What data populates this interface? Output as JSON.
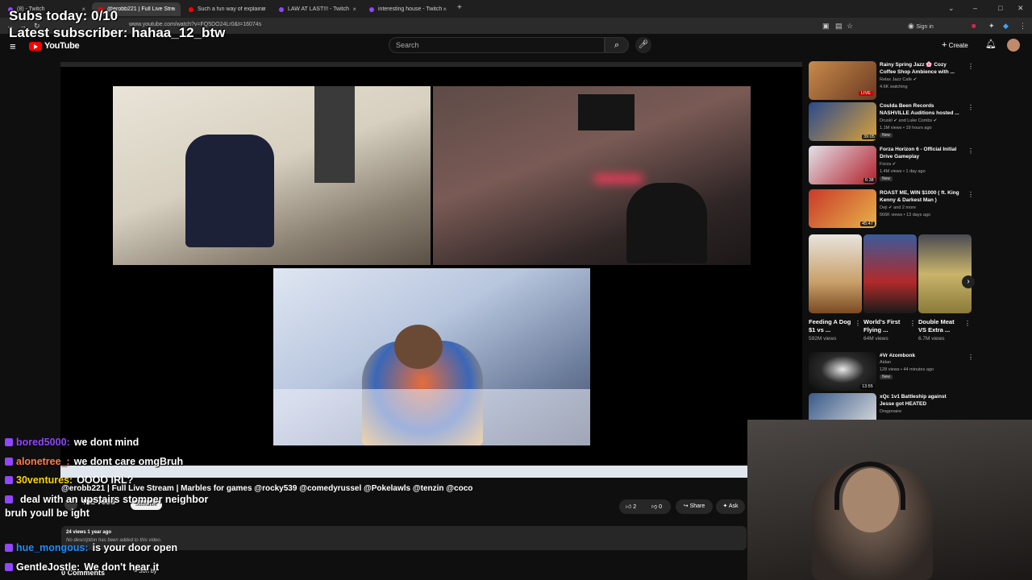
{
  "browser": {
    "tabs": [
      {
        "label": "(8) - Twitch",
        "active": false,
        "icon_color": "#9146ff"
      },
      {
        "label": "@erobb221 | Full Live Stream |",
        "active": true,
        "icon_color": "#ff0000"
      },
      {
        "label": "Such a fun way of explaining co",
        "active": false,
        "icon_color": "#ff0000"
      },
      {
        "label": "LAW AT LAST!!! - Twitch",
        "active": false,
        "icon_color": "#9146ff"
      },
      {
        "label": "interesting house - Twitch",
        "active": false,
        "icon_color": "#9146ff"
      }
    ],
    "url": "www.youtube.com/watch?v=FQ5DO24Lr0&t=16074s",
    "sign_in": "Sign in"
  },
  "youtube": {
    "logo_text": "YouTube",
    "search_placeholder": "Search",
    "create_label": "Create",
    "video": {
      "title": "@erobb221 | Full Live Stream | Marbles for games @rocky539 @comedyrussel @Pokelawls @tenzin @coco",
      "channel": "THE VODS",
      "subscribe_label": "Subscribe",
      "likes": "2",
      "dislikes": "0",
      "share_label": "Share",
      "ask_label": "Ask",
      "stats": "24 views  1 year ago",
      "description": "No description has been added to this video.",
      "comments": "0 Comments",
      "sort_label": "Sort by"
    },
    "recommendations": [
      {
        "title": "Rainy Spring Jazz 🌸 Cozy Coffee Shop Ambience with ...",
        "channel": "Relax Jazz Cafe ✔",
        "meta": "4.6K watching",
        "badge": "",
        "duration": "",
        "live": "LIVE",
        "thumb": "#a0623a"
      },
      {
        "title": "Coulda Been Records NASHVILLE Auditions hosted ...",
        "channel": "DruskI ✔ and Luke Combs ✔",
        "meta": "1.1M views • 19 hours ago",
        "badge": "New",
        "duration": "39:05",
        "live": "",
        "thumb": "#2a4a8c"
      },
      {
        "title": "Forza Horizon 6 - Official Initial Drive Gameplay",
        "channel": "Forza ✔",
        "meta": "1.4M views • 1 day ago",
        "badge": "New",
        "duration": "6:38",
        "live": "",
        "thumb": "#c8c8d0"
      },
      {
        "title": "ROAST ME, WIN $1000 ( ft. King Kenny & Darkest Man )",
        "channel": "Deji ✔ and 2 more",
        "meta": "566K views • 13 days ago",
        "badge": "",
        "duration": "45:47",
        "live": "",
        "thumb": "#b53a2a"
      },
      {
        "title": "#Vr #zombonk",
        "channel": "Aidan",
        "meta": "128 views • 44 minutes ago",
        "badge": "New",
        "duration": "13:55",
        "live": "",
        "thumb": "#111111"
      },
      {
        "title": "xQc 1v1 Battleship against Jesse got HEATED",
        "channel": "Dragonaire",
        "meta": "",
        "badge": "",
        "duration": "",
        "live": "",
        "thumb": "#3a5a8a"
      }
    ],
    "shorts": [
      {
        "title": "Feeding A Dog $1 vs ...",
        "views": "592M views",
        "thumb": "#c9a06a"
      },
      {
        "title": "World's First Flying ...",
        "views": "64M views",
        "thumb": "#b22a2a"
      },
      {
        "title": "Double Meat VS Extra ...",
        "views": "6.7M views",
        "thumb": "#c9b46a"
      }
    ]
  },
  "overlay": {
    "subs_today": "Subs today: 0/10",
    "latest_subscriber": "Latest subscriber: hahaa_12_btw",
    "chat": [
      {
        "user": "bored5000:",
        "msg": "we dont mind",
        "color": "#9146ff"
      },
      {
        "user": "alonetree_:",
        "msg": "we dont care omgBruh",
        "color": "#ff7f50"
      },
      {
        "user": "30ventures:",
        "msg": "OOOO IRL?",
        "color": "#ffd700"
      },
      {
        "user": "",
        "msg": "deal with an upstairs stomper neighbor bruh youll be ight",
        "color": "#9146ff"
      },
      {
        "user": "hue_mongous:",
        "msg": "is your door open",
        "color": "#1e90ff"
      },
      {
        "user": "GentleJostle:",
        "msg": "We don't hear it",
        "color": "#ffffff"
      }
    ]
  }
}
